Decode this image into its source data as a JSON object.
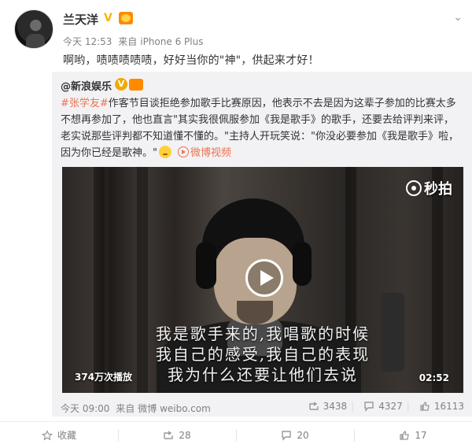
{
  "post": {
    "author": "兰天洋",
    "time": "今天 12:53",
    "source_prefix": "来自",
    "source": "iPhone 6 Plus",
    "text": "啊哟，啧啧啧啧啧，好好当你的\"神\"，供起来才好！"
  },
  "repost": {
    "author": "@新浪娱乐",
    "topic": "#张学友#",
    "text_main": "作客节目谈拒绝参加歌手比赛原因，他表示不去是因为这辈子参加的比赛太多不想再参加了，他也直言\"其实我很佩服参加《我是歌手》的歌手，还要去给评判来评，老实说那些评判都不知道懂不懂的。\"主持人开玩笑说：\"你没必要参加《我是歌手》啦，因为你已经是歌神。\"",
    "video_link": "微博视频",
    "video": {
      "watermark": "秒拍",
      "subtitle_lines": [
        "我是歌手来的,我唱歌的时候",
        "我自己的感受,我自己的表现",
        "我为什么还要让他们去说"
      ],
      "views": "374万次播放",
      "duration": "02:52"
    },
    "time": "今天 09:00",
    "source_prefix": "来自",
    "source": "微博 weibo.com",
    "stats": {
      "reposts": "3438",
      "comments": "4327",
      "likes": "16113"
    }
  },
  "actions": {
    "favorite": "收藏",
    "repost": "28",
    "comment": "20",
    "like": "17"
  },
  "colors": {
    "accent": "#eb7350",
    "muted": "#808080",
    "repost_bg": "#f2f2f5"
  }
}
